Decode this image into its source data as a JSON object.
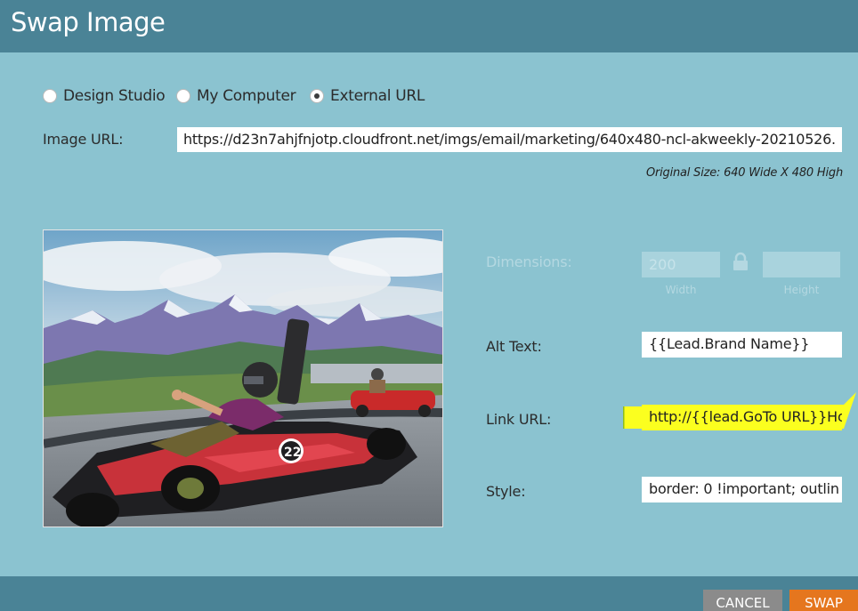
{
  "dialog": {
    "title": "Swap Image"
  },
  "source": {
    "options": [
      {
        "label": "Design Studio",
        "selected": false
      },
      {
        "label": "My Computer",
        "selected": false
      },
      {
        "label": "External URL",
        "selected": true
      }
    ]
  },
  "image_url": {
    "label": "Image URL:",
    "value": "https://d23n7ahjfnjotp.cloudfront.net/imgs/email/marketing/640x480-ncl-akweekly-20210526.",
    "original_size": "Original Size: 640 Wide X 480 High"
  },
  "dimensions": {
    "label": "Dimensions:",
    "width_value": "200",
    "height_value": "",
    "width_label": "Width",
    "height_label": "Height",
    "lock_icon": "lock-icon"
  },
  "alt_text": {
    "label": "Alt Text:",
    "value": "{{Lead.Brand Name}}"
  },
  "link_url": {
    "label": "Link URL:",
    "value": "http://{{lead.GoTo URL}}Hot",
    "highlight_color": "#fbff1f"
  },
  "style": {
    "label": "Style:",
    "value": "border: 0 !important; outlin"
  },
  "footer": {
    "cancel_label": "CANCEL",
    "swap_label": "SWAP"
  },
  "colors": {
    "header": "#4a8396",
    "body": "#8bc3d0",
    "cancel": "#8b8b8b",
    "swap": "#e5761e"
  }
}
